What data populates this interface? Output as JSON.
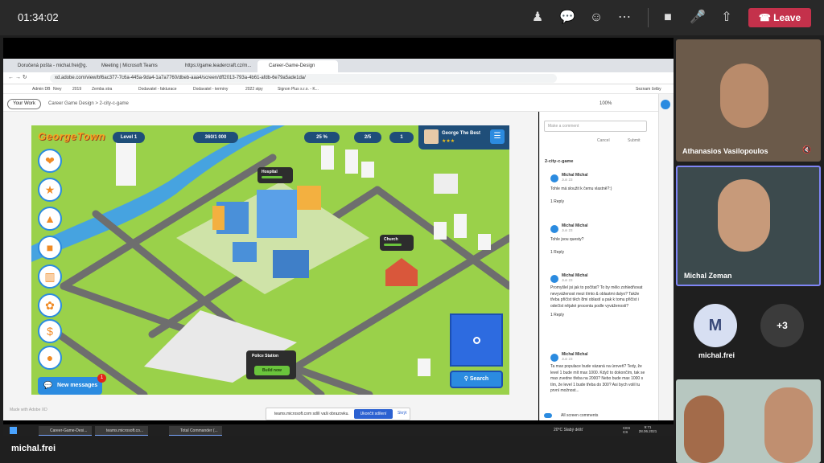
{
  "teams": {
    "timer": "01:34:02",
    "leave_label": "Leave",
    "self_name": "michal.frei",
    "icons": [
      "people-icon",
      "chat-icon",
      "reactions-icon",
      "more-icon",
      "camera-icon",
      "mic-icon",
      "share-icon",
      "phone-icon"
    ],
    "accent": "#c4314b"
  },
  "participants": {
    "p1": {
      "name": "Athanasios Vasilopoulos"
    },
    "p2": {
      "name": "Michal Zeman"
    },
    "p3": {
      "initial": "M",
      "name": "michal.frei"
    },
    "more": "+3"
  },
  "browser": {
    "tabs": [
      "Doručená pošta - michal.frei@g...",
      "Meeting | Microsoft Teams",
      "https://game.leadercraft.cz/m...",
      "Career-Game-Design"
    ],
    "url": "xd.adobe.com/view/bf6ac377-7c6a-445a-9da4-1a7a7760/dbeb-aaa4/screen/dff2013-793a-4b61-afdb-6e79a5ade1da/",
    "bookmarks": [
      "Admin DB",
      "Nrey",
      "2019",
      "Zemba stra",
      "Dodavatel - fakturace",
      "Dodavatel - terminy",
      "2022 stpy",
      "Signon Plus s.r.o. - K...",
      "Seznam četby"
    ]
  },
  "xd": {
    "your_work": "Your Work",
    "crumb": "Career Game Design  >  2-city-c-game",
    "zoom": "100%",
    "made_with": "Made with Adobe XD",
    "share_toast": "teams.microsoft.com sdílí vaši obrazovku.",
    "stop_sharing": "Ukončit sdílení",
    "hide": "Skrýt"
  },
  "game": {
    "logo": "GeorgeTown",
    "level": "Level 1",
    "coins": "360/1 000",
    "happiness": "25 %",
    "target": "2/5",
    "people": "1",
    "profile_name": "George The Best",
    "stars": "★★★",
    "hospital": "Hospital",
    "church": "Church",
    "police": "Police Station",
    "build_now": "Build now",
    "new_messages": "New messages",
    "msg_count": "1",
    "search": "Search"
  },
  "comments": {
    "placeholder": "Make a comment",
    "cancel": "Cancel",
    "submit": "Submit",
    "thread_title": "2-city-c-game",
    "all_screen": "All screen comments",
    "items": [
      {
        "author": "Michal Michal",
        "date": "Jun 23",
        "text": "Tohle má sloužit k čemu vlastně?:)",
        "reply": "1 Reply"
      },
      {
        "author": "Michal Michal",
        "date": "Jun 23",
        "text": "Tohle jsou questy?",
        "reply": "1 Reply"
      },
      {
        "author": "Michal Michal",
        "date": "Jun 23",
        "text": "Promyšlel jsi jak to počítat? To by mělo zohledňovat nevyváženost mezi tímto & oblastmi dalyo? Takže třeba přičíst těch 8mi oblastí a pak k tomu přičíst i odečíst nějaké procenta podle vyváženosti?",
        "reply": "1 Reply"
      },
      {
        "author": "Michal Michal",
        "date": "Jun 23",
        "text": "Ta max populace bude vázaná na úroveň? Tedy, že level 1 bude mít max 1000. Když to dokončím, tak se max zvedne třeba na 2000? Nebo bude max 1000 s tím, že level 1 bude třeba do 300? Asi bych volil tu první možnost..."
      }
    ]
  },
  "taskbar": {
    "tasks": [
      "Career-Game-Desi...",
      "teams.microsoft.co...",
      "Total Commander (..."
    ],
    "weather": "20°C  Slabý déšť",
    "lang": "CES CS",
    "time": "9:71",
    "date": "28.06.2021"
  }
}
